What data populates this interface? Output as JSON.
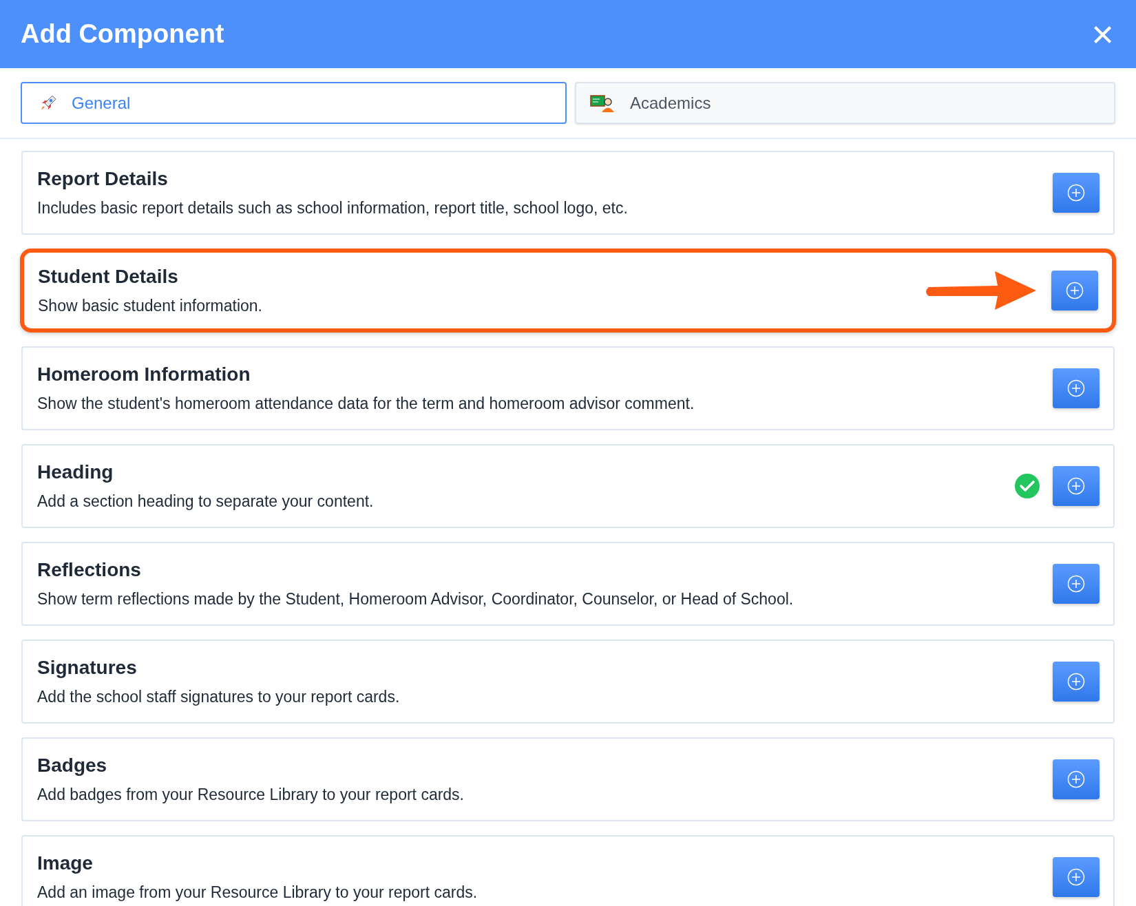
{
  "dialog": {
    "title": "Add Component",
    "close": "×"
  },
  "tabs": [
    {
      "label": "General",
      "selected": true,
      "kind": "rocket"
    },
    {
      "label": "Academics",
      "selected": false,
      "kind": "teacher"
    }
  ],
  "components": [
    {
      "title": "Report Details",
      "description": "Includes basic report details such as school information, report title, school logo, etc.",
      "added": false,
      "highlighted": false
    },
    {
      "title": "Student Details",
      "description": "Show basic student information.",
      "added": false,
      "highlighted": true
    },
    {
      "title": "Homeroom Information",
      "description": "Show the student's homeroom attendance data for the term and homeroom advisor comment.",
      "added": false,
      "highlighted": false
    },
    {
      "title": "Heading",
      "description": "Add a section heading to separate your content.",
      "added": true,
      "highlighted": false
    },
    {
      "title": "Reflections",
      "description": "Show term reflections made by the Student, Homeroom Advisor, Coordinator, Counselor, or Head of School.",
      "added": false,
      "highlighted": false
    },
    {
      "title": "Signatures",
      "description": "Add the school staff signatures to your report cards.",
      "added": false,
      "highlighted": false
    },
    {
      "title": "Badges",
      "description": "Add badges from your Resource Library to your report cards.",
      "added": false,
      "highlighted": false
    },
    {
      "title": "Image",
      "description": "Add an image from your Resource Library to your report cards.",
      "added": false,
      "highlighted": false
    }
  ]
}
